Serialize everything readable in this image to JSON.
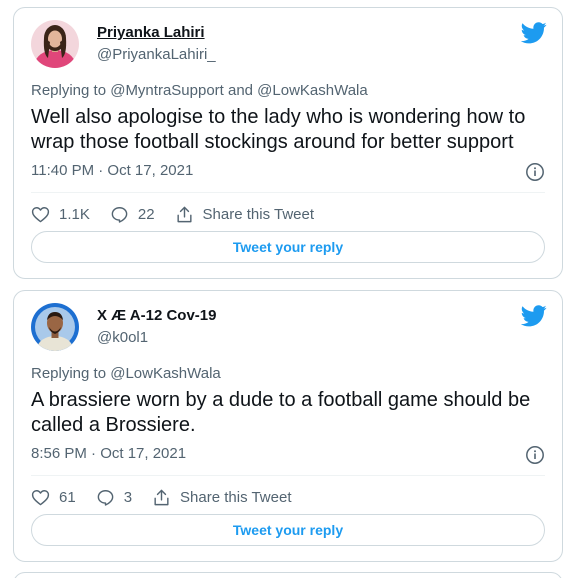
{
  "colors": {
    "accent": "#1d9bf0",
    "text_primary": "#0f1419",
    "text_secondary": "#536471",
    "border": "#cfd9de"
  },
  "tweets": [
    {
      "author": {
        "name": "Priyanka Lahiri",
        "handle": "@PriyankaLahiri_"
      },
      "replying_to": "Replying to @MyntraSupport and @LowKashWala",
      "text": "Well also apologise to the lady who is wondering how to wrap those football stockings around for better support",
      "timestamp": "11:40 PM · Oct 17, 2021",
      "likes": "1.1K",
      "replies": "22",
      "share_label": "Share this Tweet",
      "reply_button_label": "Tweet your reply",
      "icons": [
        "twitter-bird-icon",
        "info-icon",
        "heart-icon",
        "reply-bubble-icon",
        "share-icon"
      ]
    },
    {
      "author": {
        "name": "X Æ A-12 Cov-19",
        "handle": "@k0ol1"
      },
      "replying_to": "Replying to @LowKashWala",
      "text": "A brassiere worn by a dude to a football game should be called a Brossiere.",
      "timestamp": "8:56 PM · Oct 17, 2021",
      "likes": "61",
      "replies": "3",
      "share_label": "Share this Tweet",
      "reply_button_label": "Tweet your reply",
      "icons": [
        "twitter-bird-icon",
        "info-icon",
        "heart-icon",
        "reply-bubble-icon",
        "share-icon"
      ]
    }
  ]
}
